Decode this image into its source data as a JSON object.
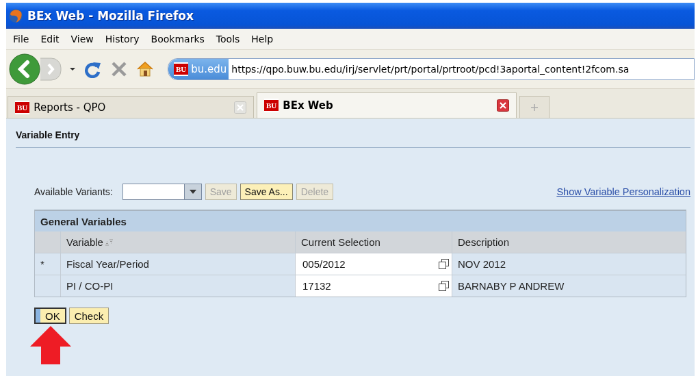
{
  "window": {
    "title": "BEx Web - Mozilla Firefox"
  },
  "menu": [
    "File",
    "Edit",
    "View",
    "History",
    "Bookmarks",
    "Tools",
    "Help"
  ],
  "address_bar": {
    "site_badge": "BU",
    "site": "bu.edu",
    "url": "https://qpo.buw.bu.edu/irj/servlet/prt/portal/prtroot/pcd!3aportal_content!2fcom.sa"
  },
  "tabs": [
    {
      "badge": "BU",
      "label": "Reports - QPO",
      "selected": false
    },
    {
      "badge": "BU",
      "label": "BEx Web",
      "selected": true
    }
  ],
  "page": {
    "title": "Variable Entry",
    "variants": {
      "label": "Available Variants:"
    },
    "variant_buttons": [
      {
        "label": "Save",
        "disabled": true
      },
      {
        "label": "Save As...",
        "disabled": false
      },
      {
        "label": "Delete",
        "disabled": true
      }
    ],
    "link": "Show Variable Personalization",
    "table": {
      "title": "General Variables",
      "columns": [
        {
          "label": "Variable",
          "sortable": true
        },
        {
          "label": "Current Selection",
          "sortable": false
        },
        {
          "label": "Description",
          "sortable": false
        }
      ],
      "rows": [
        {
          "marker": "*",
          "variable": "Fiscal Year/Period",
          "selection": "005/2012",
          "description": "NOV 2012"
        },
        {
          "variable": "PI / CO-PI",
          "selection": "17132",
          "description": "BARNABY P ANDREW"
        }
      ]
    },
    "actions": [
      {
        "label": "OK",
        "focused": true
      },
      {
        "label": "Check",
        "focused": false
      }
    ],
    "annotation": {
      "kind": "arrow"
    }
  }
}
